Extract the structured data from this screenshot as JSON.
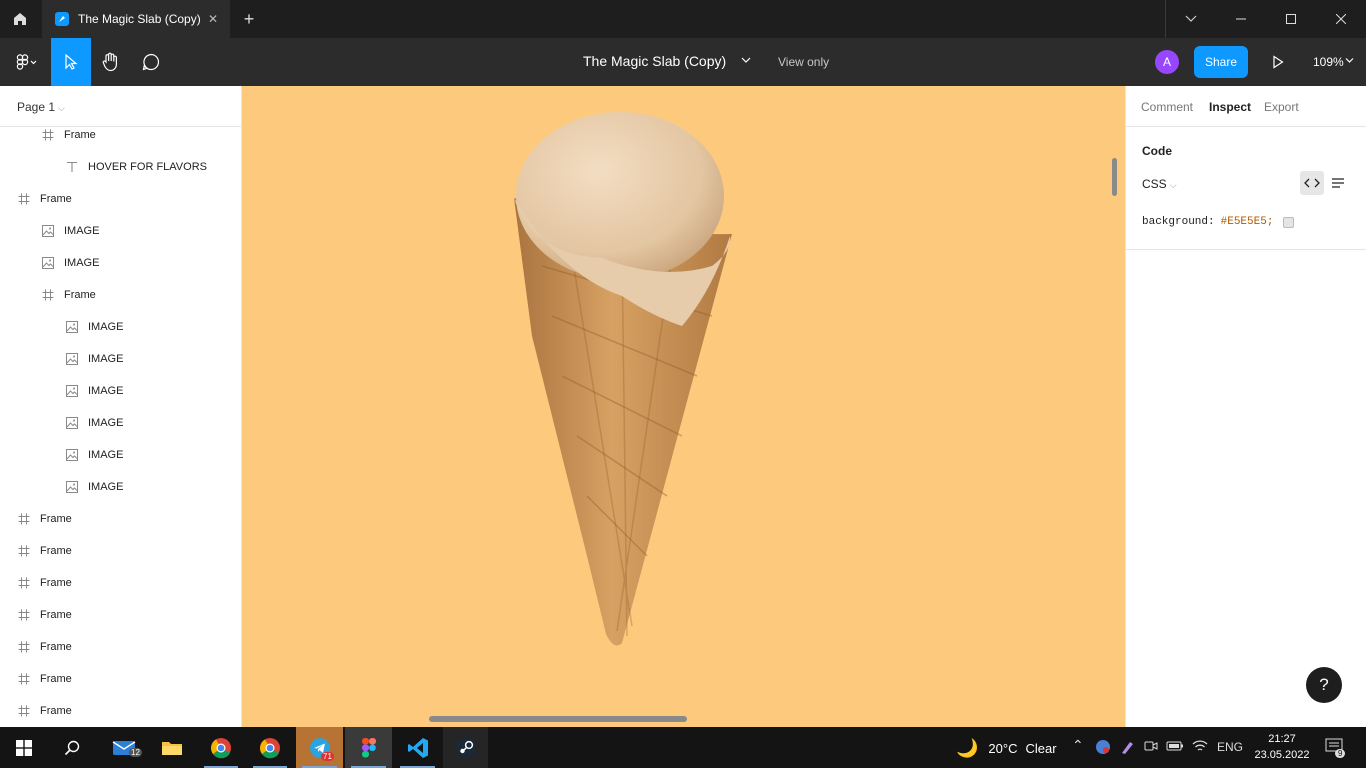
{
  "titlebar": {
    "tab_title": "The Magic Slab (Copy)"
  },
  "toolbar": {
    "doc_title": "The Magic Slab (Copy)",
    "view_only": "View only",
    "avatar_initial": "A",
    "share_label": "Share",
    "zoom": "109%"
  },
  "layers_panel": {
    "page_label": "Page 1",
    "layers": [
      {
        "name": "Frame",
        "type": "frame"
      },
      {
        "name": "HOVER FOR FLAVORS",
        "type": "text"
      },
      {
        "name": "Frame",
        "type": "frame"
      },
      {
        "name": "IMAGE",
        "type": "image"
      },
      {
        "name": "IMAGE",
        "type": "image"
      },
      {
        "name": "Frame",
        "type": "frame"
      },
      {
        "name": "IMAGE",
        "type": "image"
      },
      {
        "name": "IMAGE",
        "type": "image"
      },
      {
        "name": "IMAGE",
        "type": "image"
      },
      {
        "name": "IMAGE",
        "type": "image"
      },
      {
        "name": "IMAGE",
        "type": "image"
      },
      {
        "name": "IMAGE",
        "type": "image"
      },
      {
        "name": "Frame",
        "type": "frame"
      },
      {
        "name": "Frame",
        "type": "frame"
      },
      {
        "name": "Frame",
        "type": "frame"
      },
      {
        "name": "Frame",
        "type": "frame"
      },
      {
        "name": "Frame",
        "type": "frame"
      },
      {
        "name": "Frame",
        "type": "frame"
      },
      {
        "name": "Frame",
        "type": "frame"
      }
    ]
  },
  "canvas": {
    "background_color": "#fdc97d"
  },
  "inspect_panel": {
    "tabs": {
      "comment": "Comment",
      "inspect": "Inspect",
      "export": "Export"
    },
    "code_heading": "Code",
    "language": "CSS",
    "css_property": "background:",
    "css_value": "#E5E5E5;",
    "help": "?"
  },
  "taskbar": {
    "mail_badge": "12",
    "telegram_badge": "71",
    "weather_temp": "20°C",
    "weather_desc": "Clear",
    "lang": "ENG",
    "time": "21:27",
    "date": "23.05.2022",
    "notif_count": "9"
  },
  "colors": {
    "accent": "#0d99ff",
    "avatar": "#9747ff",
    "canvas": "#fdc97d"
  }
}
